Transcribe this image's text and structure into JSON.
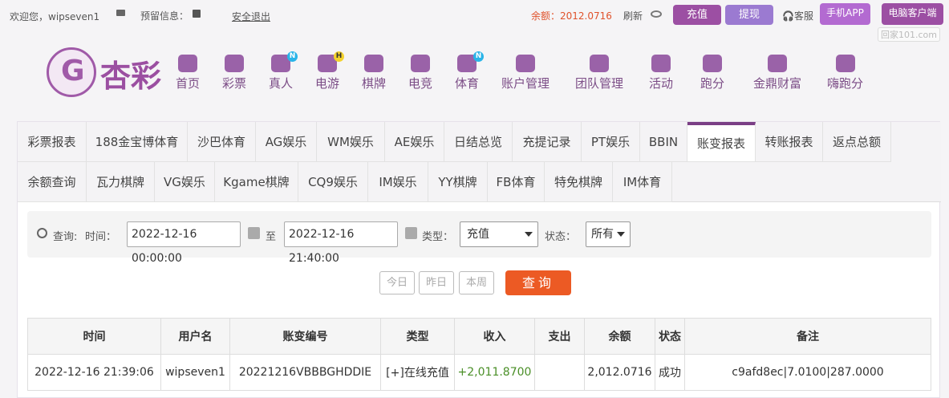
{
  "topbar": {
    "welcome": "欢迎您，wipseven1",
    "notice": "预留信息：",
    "logout": "安全退出",
    "balance": "余额：2012.0716",
    "refresh": "刷新",
    "recharge": "充值",
    "withdraw": "提现",
    "service": "客服",
    "app": "手机APP",
    "pc": "电脑客户端"
  },
  "watermark": "回家101.com",
  "logo": "杏彩",
  "nav": [
    "首页",
    "彩票",
    "真人",
    "电游",
    "棋牌",
    "电竞",
    "体育",
    "账户管理",
    "团队管理",
    "活动",
    "跑分",
    "金鼎财富",
    "嗨跑分"
  ],
  "nav_badges": {
    "zhenren": "N",
    "dianyou": "H",
    "tiyu": "N"
  },
  "tabs_row1": [
    "彩票报表",
    "188金宝博体育",
    "沙巴体育",
    "AG娱乐",
    "WM娱乐",
    "AE娱乐",
    "日结总览",
    "充提记录",
    "PT娱乐",
    "BBIN",
    "账变报表",
    "转账报表",
    "返点总额"
  ],
  "tabs_row2": [
    "余额查询",
    "瓦力棋牌",
    "VG娱乐",
    "Kgame棋牌",
    "CQ9娱乐",
    "IM娱乐",
    "YY棋牌",
    "FB体育",
    "特免棋牌",
    "IM体育"
  ],
  "query": {
    "label": "查询:",
    "time_label": "时间：",
    "start": "2022-12-16 00:00:00",
    "to": "至",
    "end": "2022-12-16 21:40:00",
    "type_label": "类型：",
    "type_value": "充值",
    "status_label": "状态：",
    "status_value": "所有",
    "today": "今日",
    "yesterday": "昨日",
    "week": "本周",
    "search": "查询"
  },
  "table": {
    "headers": [
      "时间",
      "用户名",
      "账变编号",
      "类型",
      "收入",
      "支出",
      "余额",
      "状态",
      "备注"
    ],
    "rows": [
      [
        "2022-12-16 21:39:06",
        "wipseven1",
        "20221216VBBBGHDDIE",
        "[+]在线充值",
        "+2,011.8700",
        "",
        "2,012.0716",
        "成功",
        "c9afd8ec|7.0100|287.0000"
      ]
    ]
  },
  "colors": {
    "brand": "#9c4fa3",
    "accent": "#ec5a24",
    "income": "#4a8f27"
  }
}
